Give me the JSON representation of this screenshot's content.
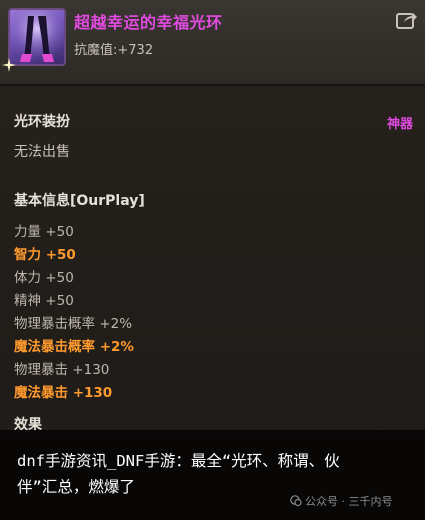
{
  "item": {
    "name": "超越幸运的幸福光环",
    "resist": "抗魔值:+732",
    "type": "光环装扮",
    "rarity": "神器",
    "trade": "无法出售"
  },
  "basic": {
    "heading": "基本信息[OurPlay]",
    "stats": [
      {
        "label": "力量 +50",
        "style": "grey"
      },
      {
        "label": "智力 +50",
        "style": "orange"
      },
      {
        "label": "体力 +50",
        "style": "grey"
      },
      {
        "label": "精神 +50",
        "style": "grey"
      },
      {
        "label": "物理暴击概率 +2%",
        "style": "grey"
      },
      {
        "label": "魔法暴击概率 +2%",
        "style": "orange"
      },
      {
        "label": "物理暴击 +130",
        "style": "grey"
      },
      {
        "label": "魔法暴击 +130",
        "style": "orange"
      }
    ]
  },
  "effect": {
    "heading": "效果"
  },
  "overlay": {
    "caption": "dnf手游资讯_DNF手游：最全“光环、称谓、伙伴”汇总，燃爆了",
    "watermark": "公众号 · 三千内号"
  },
  "colors": {
    "title": "#e14be0",
    "highlight": "#ff9a2e",
    "text": "#c9c2b8"
  },
  "icons": [
    "item-icon",
    "sparkle-icon",
    "share-icon",
    "wechat-icon"
  ]
}
